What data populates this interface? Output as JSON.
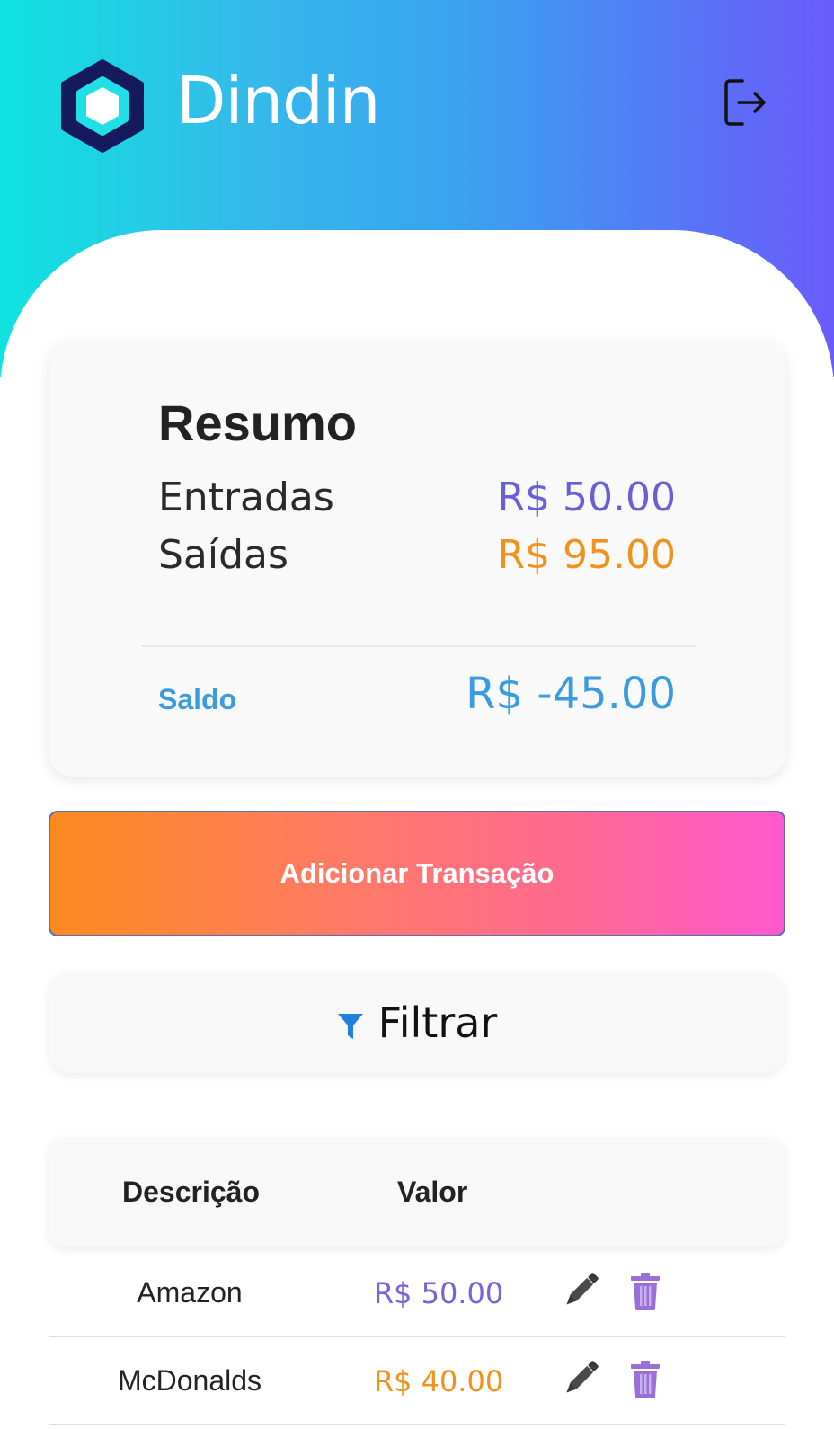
{
  "app": {
    "title": "Dindin",
    "colors": {
      "header_gradient": [
        "#0fe3e0",
        "#3aa3f0",
        "#6a5bfb"
      ],
      "income": "#6a5fd6",
      "expense": "#f0921e",
      "balance": "#3a9be0",
      "add_button_gradient": [
        "#fa8a1e",
        "#ff58cf"
      ],
      "trash": "#9a6fd8"
    }
  },
  "header": {
    "logo_icon": "hexagon-logo-icon",
    "logout_icon": "logout-icon"
  },
  "summary": {
    "title": "Resumo",
    "income_label": "Entradas",
    "income_value": "R$ 50.00",
    "expense_label": "Saídas",
    "expense_value": "R$ 95.00",
    "balance_label": "Saldo",
    "balance_value": "R$ -45.00"
  },
  "actions": {
    "add_transaction_label": "Adicionar Transação",
    "filter_label": "Filtrar",
    "filter_icon": "funnel-icon"
  },
  "table": {
    "headers": {
      "description": "Descrição",
      "value": "Valor"
    },
    "rows": [
      {
        "description": "Amazon",
        "value": "R$ 50.00",
        "type": "income"
      },
      {
        "description": "McDonalds",
        "value": "R$ 40.00",
        "type": "expense"
      }
    ],
    "edit_icon": "pencil-icon",
    "delete_icon": "trash-icon"
  }
}
